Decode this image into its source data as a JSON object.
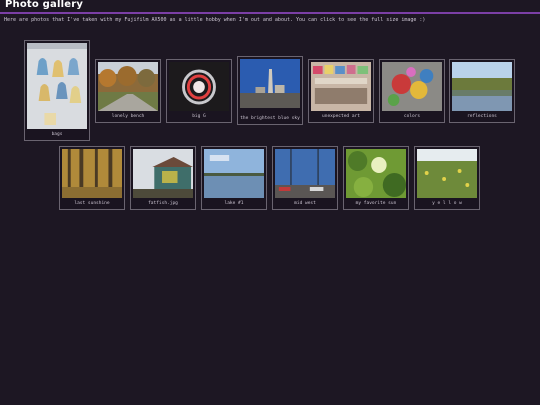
{
  "header": {
    "title": "Photo gallery"
  },
  "intro": "Here are photos that I've taken with my Fujifilm AX500 as a little hobby when I'm out and about. You can click to see the full size image :)",
  "photos": [
    {
      "caption": "bags"
    },
    {
      "caption": "lonely bench"
    },
    {
      "caption": "big G"
    },
    {
      "caption": "the brightest blue sky"
    },
    {
      "caption": "unexpected art"
    },
    {
      "caption": "colors"
    },
    {
      "caption": "reflections"
    },
    {
      "caption": "last sunshine"
    },
    {
      "caption": "fatfish.jpg"
    },
    {
      "caption": "lake #1"
    },
    {
      "caption": "mid west"
    },
    {
      "caption": "my favorite sun"
    },
    {
      "caption": "y e l l o w"
    }
  ]
}
